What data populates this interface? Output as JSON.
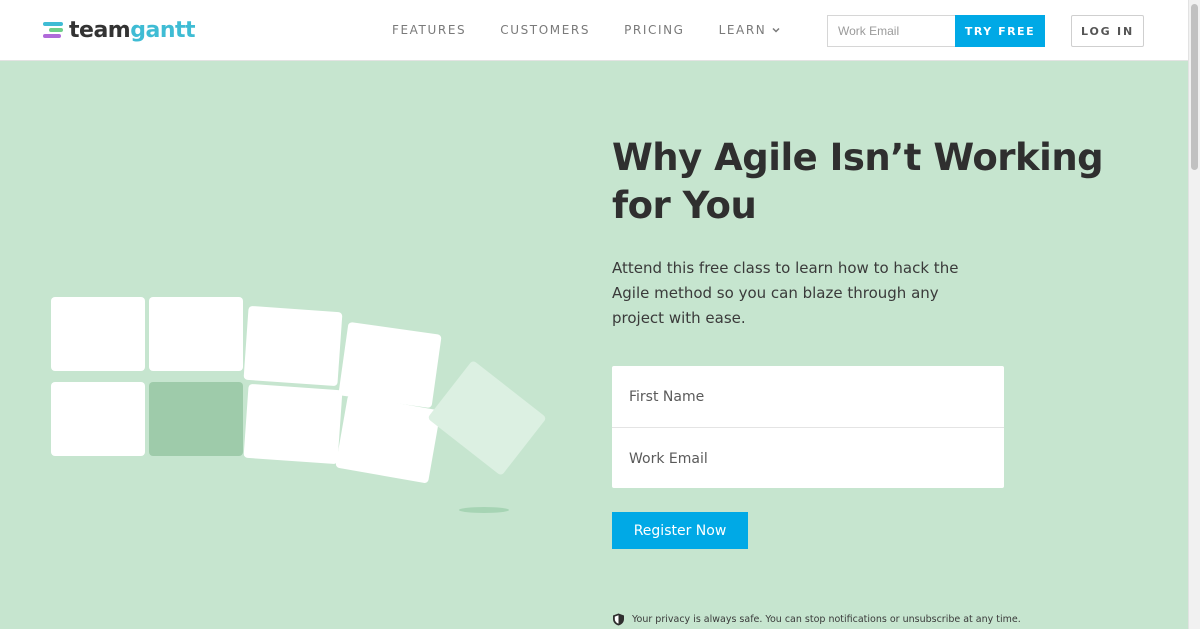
{
  "header": {
    "logo": {
      "team": "team",
      "gantt": "gantt"
    },
    "nav": [
      {
        "label": "FEATURES",
        "icon": null
      },
      {
        "label": "CUSTOMERS",
        "icon": null
      },
      {
        "label": "PRICING",
        "icon": null
      },
      {
        "label": "LEARN",
        "icon": "chevron-down-icon"
      }
    ],
    "email_placeholder": "Work Email",
    "try_label": "TRY FREE",
    "login_label": "LOG IN"
  },
  "hero": {
    "title": "Why Agile Isn’t Working for You",
    "description": "Attend this free class to learn how to hack the Agile method so you can blaze through any project with ease.",
    "form": {
      "first_name_placeholder": "First Name",
      "email_placeholder": "Work Email",
      "submit_label": "Register Now"
    },
    "privacy_text": "Your privacy is always safe. You can stop notifications or unsubscribe at any time."
  },
  "colors": {
    "accent": "#00a9e6",
    "hero_bg": "#c6e5cf",
    "tile_dark": "#9ecbaa",
    "logo_gantt": "#3fbcd4"
  }
}
